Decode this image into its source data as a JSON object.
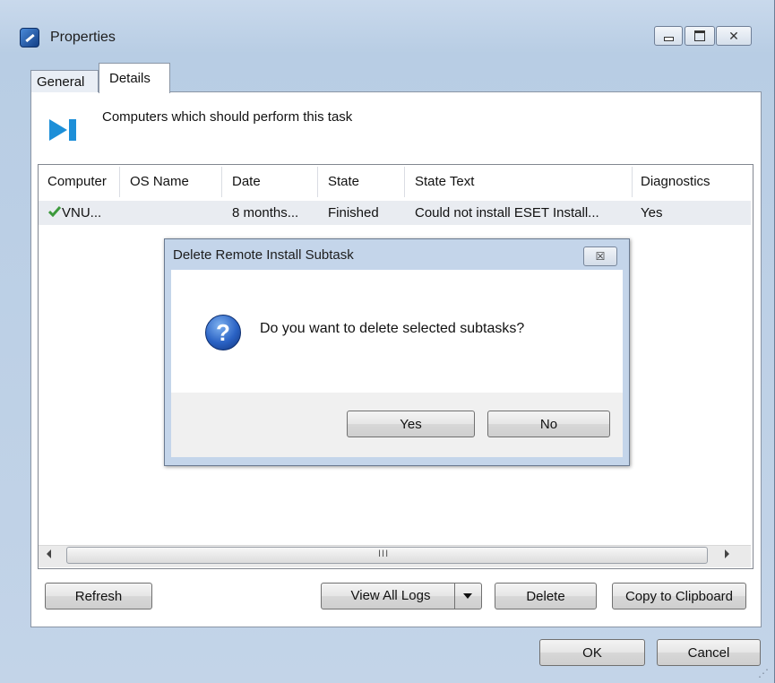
{
  "window": {
    "title": "Properties",
    "caption_close": "✕"
  },
  "tabs": [
    {
      "label": "General"
    },
    {
      "label": "Details"
    }
  ],
  "details": {
    "header_text": "Computers which should perform this task"
  },
  "list": {
    "columns": [
      "Computer",
      "OS Name",
      "Date",
      "State",
      "State Text",
      "Diagnostics"
    ],
    "rows": [
      {
        "computer": "VNU...",
        "os_name": "",
        "date": "8 months...",
        "state": "Finished",
        "state_text": "Could not install ESET Install...",
        "diagnostics": "Yes"
      }
    ],
    "scroll_grip": "III"
  },
  "buttons": {
    "refresh": "Refresh",
    "view_all_logs": "View All Logs",
    "delete": "Delete",
    "copy_to_clipboard": "Copy to Clipboard",
    "ok": "OK",
    "cancel": "Cancel"
  },
  "dialog": {
    "title": "Delete Remote Install Subtask",
    "close": "☒",
    "message": "Do you want to delete selected subtasks?",
    "icon_glyph": "?",
    "yes": "Yes",
    "no": "No"
  },
  "colors": {
    "chrome": "#c4d5ea",
    "selected_row": "#e9ecf1",
    "check": "#3c9a3c"
  }
}
